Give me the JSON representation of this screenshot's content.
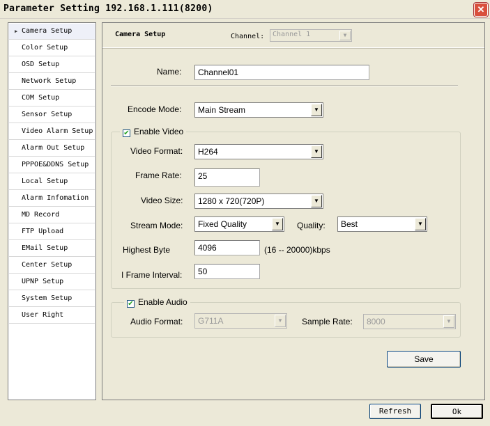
{
  "window": {
    "title": "Parameter Setting 192.168.1.111(8200)",
    "close_glyph": "✕"
  },
  "sidebar": {
    "items": [
      {
        "label": "Camera Setup",
        "active": true
      },
      {
        "label": "Color Setup"
      },
      {
        "label": "OSD Setup"
      },
      {
        "label": "Network Setup"
      },
      {
        "label": "COM Setup"
      },
      {
        "label": "Sensor Setup"
      },
      {
        "label": "Video Alarm Setup"
      },
      {
        "label": "Alarm Out Setup"
      },
      {
        "label": "PPPOE&DDNS Setup"
      },
      {
        "label": "Local Setup"
      },
      {
        "label": "Alarm Infomation"
      },
      {
        "label": "MD Record"
      },
      {
        "label": "FTP Upload"
      },
      {
        "label": "EMail Setup"
      },
      {
        "label": "Center Setup"
      },
      {
        "label": "UPNP Setup"
      },
      {
        "label": "System Setup"
      },
      {
        "label": "User Right"
      }
    ]
  },
  "panel": {
    "title": "Camera Setup",
    "channel_label": "Channel:",
    "channel_value": "Channel 1",
    "name_label": "Name:",
    "name_value": "Channel01",
    "encode_mode_label": "Encode Mode:",
    "encode_mode_value": "Main Stream",
    "video": {
      "enable_label": "Enable Video",
      "enabled": true,
      "format_label": "Video Format:",
      "format_value": "H264",
      "frame_rate_label": "Frame Rate:",
      "frame_rate_value": "25",
      "size_label": "Video Size:",
      "size_value": "1280 x 720(720P)",
      "stream_mode_label": "Stream Mode:",
      "stream_mode_value": "Fixed Quality",
      "quality_label": "Quality:",
      "quality_value": "Best",
      "highest_byte_label": "Highest Byte",
      "highest_byte_value": "4096",
      "highest_byte_range": "(16 -- 20000)kbps",
      "iframe_label": "I Frame Interval:",
      "iframe_value": "50"
    },
    "audio": {
      "enable_label": "Enable Audio",
      "enabled": true,
      "format_label": "Audio Format:",
      "format_value": "G711A",
      "sample_rate_label": "Sample Rate:",
      "sample_rate_value": "8000"
    },
    "save_label": "Save"
  },
  "footer": {
    "refresh_label": "Refresh",
    "ok_label": "Ok"
  },
  "glyphs": {
    "dropdown": "▼",
    "check": "✔",
    "active_arrow": "▶"
  }
}
